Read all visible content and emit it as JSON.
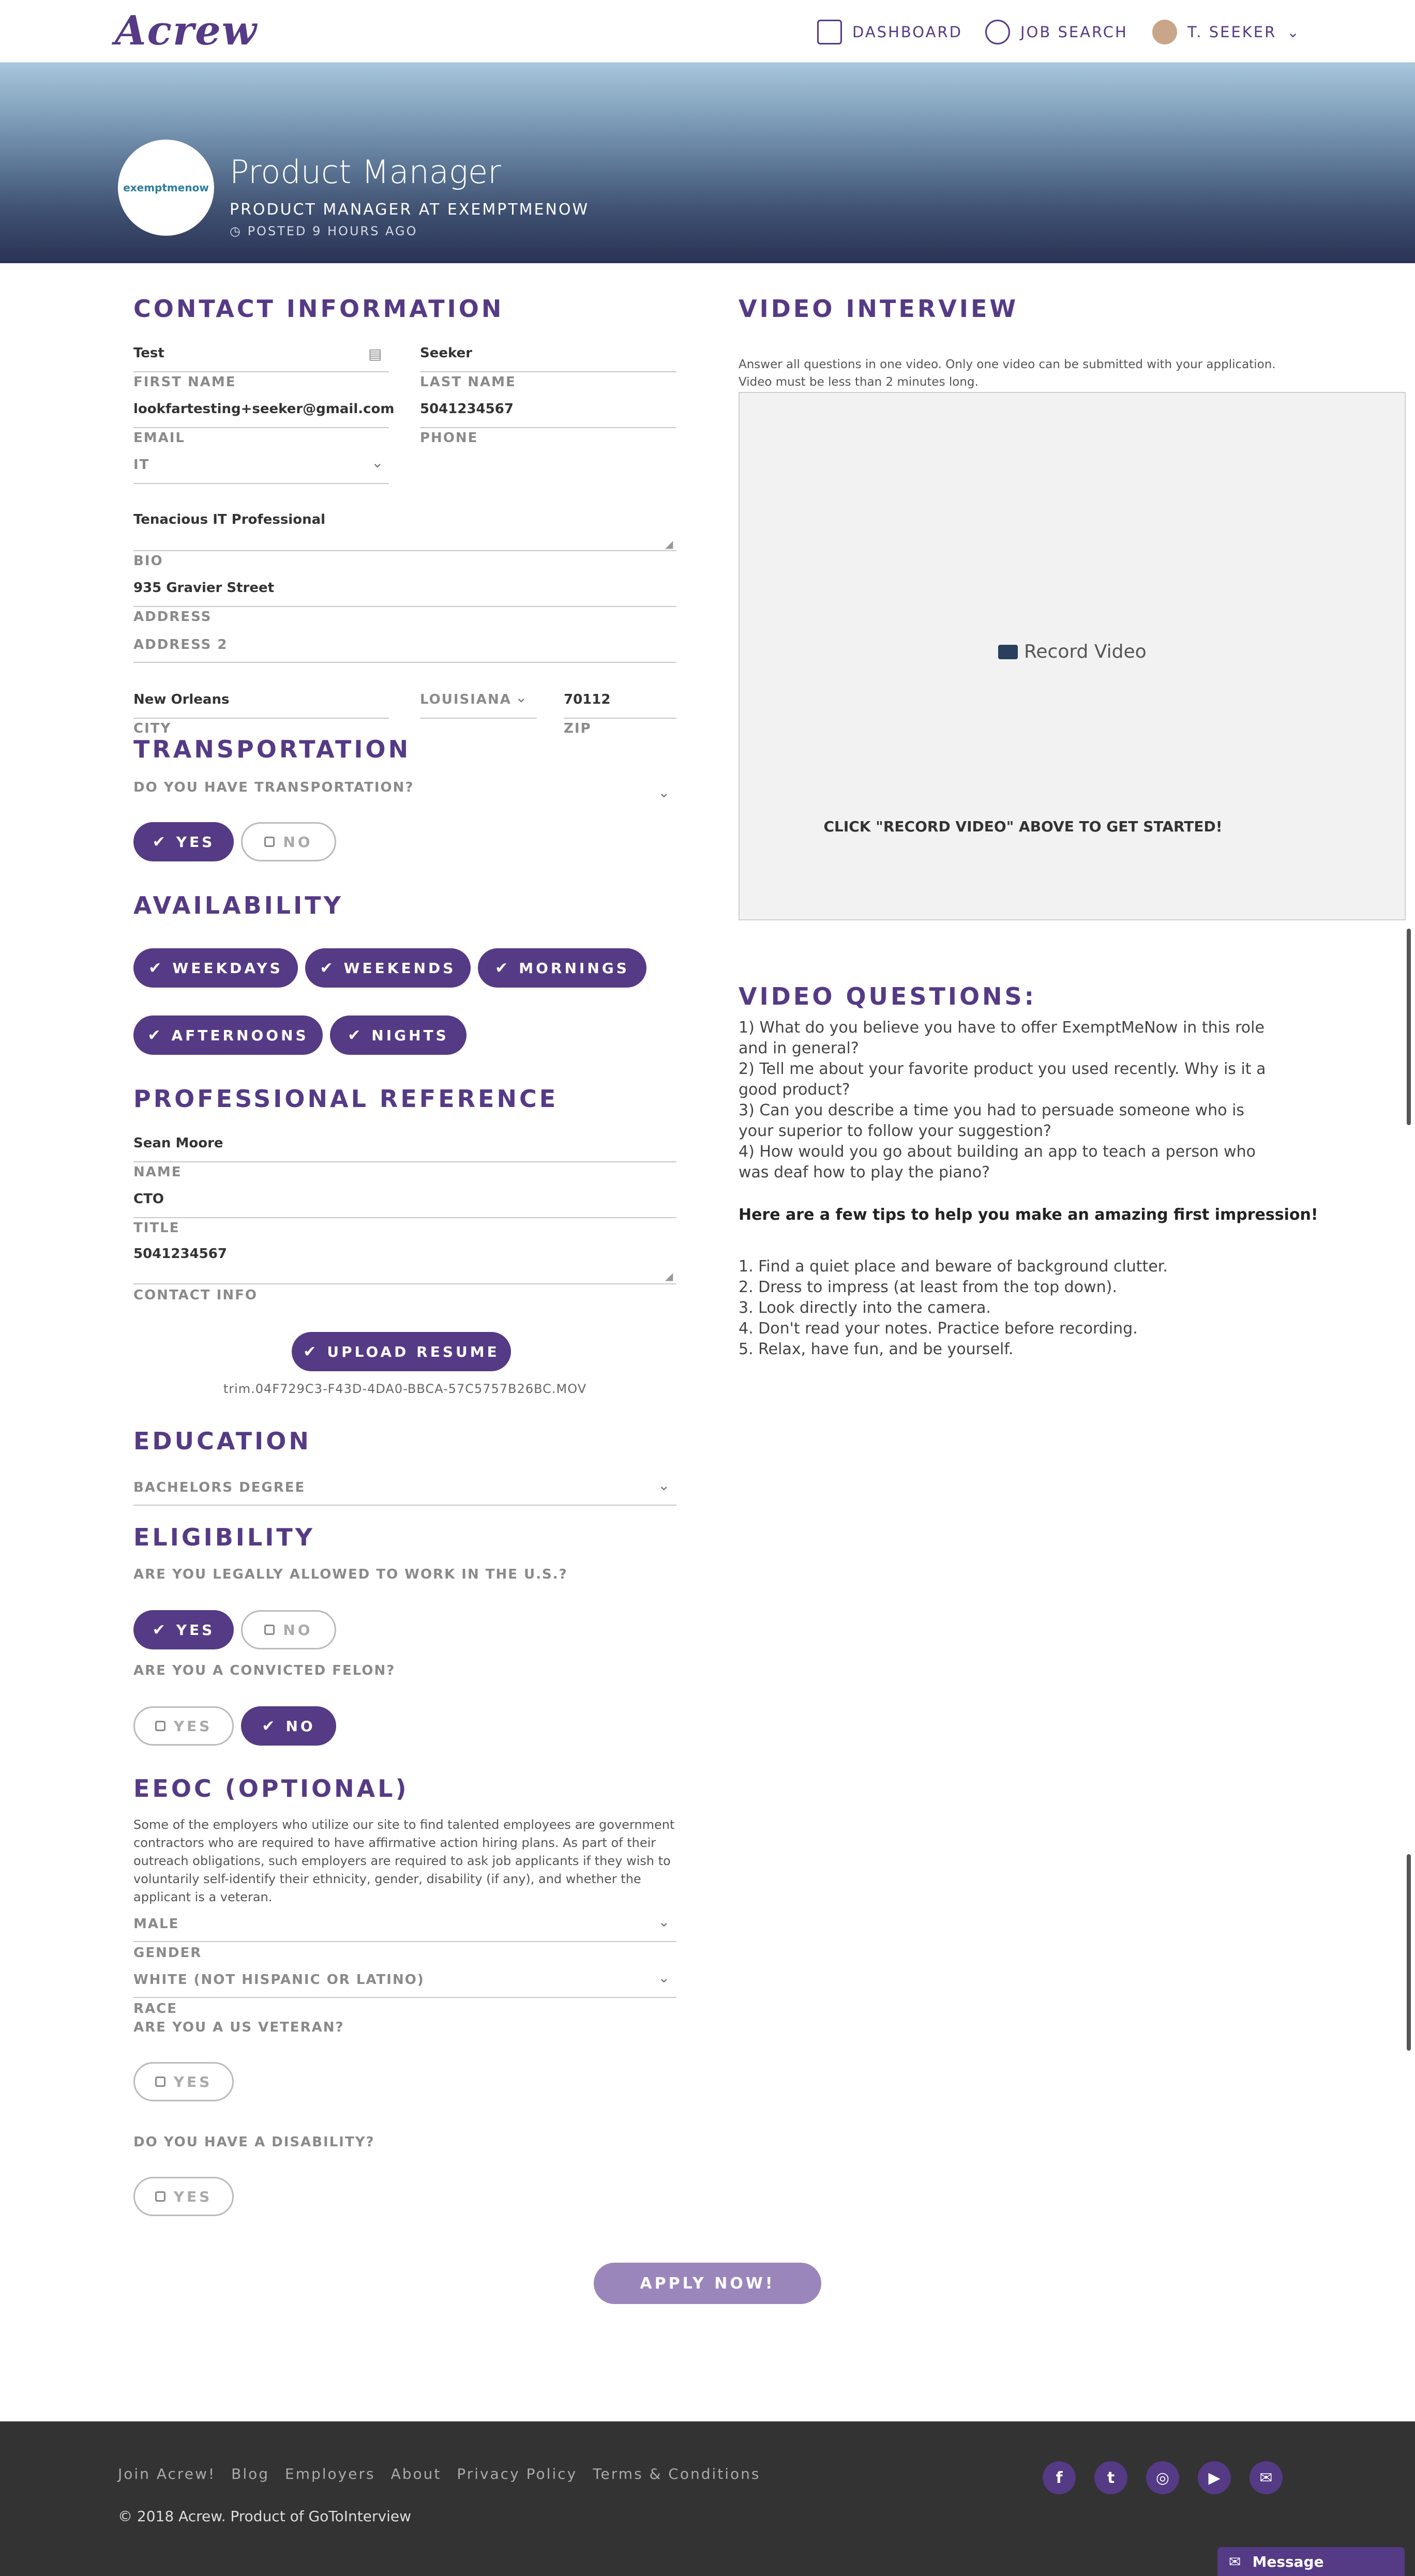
{
  "header": {
    "logo": "Acrew",
    "nav": {
      "dashboard": "DASHBOARD",
      "job_search": "JOB SEARCH",
      "user": "T. SEEKER"
    }
  },
  "banner": {
    "company_logo_text": "exemptmenow",
    "title": "Product Manager",
    "subtitle": "PRODUCT MANAGER AT EXEMPTMENOW",
    "posted": "POSTED 9 HOURS AGO"
  },
  "contact": {
    "heading": "CONTACT INFORMATION",
    "first_name": {
      "value": "Test",
      "label": "FIRST NAME"
    },
    "last_name": {
      "value": "Seeker",
      "label": "LAST NAME"
    },
    "email": {
      "value": "lookfartesting+seeker@gmail.com",
      "label": "EMAIL"
    },
    "phone": {
      "value": "5041234567",
      "label": "PHONE"
    },
    "industry": {
      "value": "IT"
    },
    "bio": {
      "value": "Tenacious IT Professional",
      "label": "BIO"
    },
    "address": {
      "value": "935 Gravier Street",
      "label": "ADDRESS"
    },
    "address2": {
      "label": "ADDRESS 2"
    },
    "city": {
      "value": "New Orleans",
      "label": "CITY"
    },
    "state": {
      "value": "LOUISIANA"
    },
    "zip": {
      "value": "70112",
      "label": "ZIP"
    }
  },
  "transportation": {
    "heading": "TRANSPORTATION",
    "question": "DO YOU HAVE TRANSPORTATION?",
    "yes": "YES",
    "no": "NO",
    "selected": "yes"
  },
  "availability": {
    "heading": "AVAILABILITY",
    "options": [
      "WEEKDAYS",
      "WEEKENDS",
      "MORNINGS",
      "AFTERNOONS",
      "NIGHTS"
    ]
  },
  "reference": {
    "heading": "PROFESSIONAL REFERENCE",
    "name": {
      "value": "Sean Moore",
      "label": "NAME"
    },
    "title": {
      "value": "CTO",
      "label": "TITLE"
    },
    "contact": {
      "value": "5041234567",
      "label": "CONTACT INFO"
    },
    "upload_label": "UPLOAD RESUME",
    "file_name": "trim.04F729C3-F43D-4DA0-BBCA-57C5757B26BC.MOV"
  },
  "education": {
    "heading": "EDUCATION",
    "value": "BACHELORS DEGREE"
  },
  "eligibility": {
    "heading": "ELIGIBILITY",
    "q1": "ARE YOU LEGALLY ALLOWED TO WORK IN THE U.S.?",
    "q2": "ARE YOU A CONVICTED FELON?",
    "yes": "YES",
    "no": "NO"
  },
  "eeoc": {
    "heading": "EEOC (OPTIONAL)",
    "text": "Some of the employers who utilize our site to find talented employees are government contractors who are required to have affirmative action hiring plans. As part of their outreach obligations, such employers are required to ask job applicants if they wish to voluntarily self-identify their ethnicity, gender, disability (if any), and whether the applicant is a veteran.",
    "gender": {
      "value": "MALE",
      "label": "GENDER"
    },
    "race": {
      "value": "WHITE (NOT HISPANIC OR LATINO)",
      "label": "RACE"
    },
    "veteran_q": "ARE YOU A US VETERAN?",
    "disability_q": "DO YOU HAVE A DISABILITY?",
    "yes": "YES"
  },
  "apply_label": "APPLY NOW!",
  "video": {
    "heading": "VIDEO INTERVIEW",
    "instructions": "Answer all questions in one video. Only one video can be submitted with your application. Video must be less than 2 minutes long.",
    "record_label": "Record Video",
    "cta": "CLICK \"RECORD VIDEO\" ABOVE TO GET STARTED!"
  },
  "questions": {
    "heading": "VIDEO QUESTIONS:",
    "items": [
      "1) What do you believe you have to offer ExemptMeNow in this role and in general?",
      "2) Tell me about your favorite product you used recently. Why is it a good product?",
      "3) Can you describe a time you had to persuade someone who is your superior to follow your suggestion?",
      "4) How would you go about building an app to teach a person who was deaf how to play the piano?"
    ],
    "tips_heading": "Here are a few tips to help you make an amazing first impression!",
    "tips": [
      "1. Find a quiet place and beware of background clutter.",
      "2. Dress to impress (at least from the top down).",
      "3. Look directly into the camera.",
      "4. Don't read your notes. Practice before recording.",
      "5. Relax, have fun, and be yourself."
    ]
  },
  "footer": {
    "links": [
      "Join Acrew!",
      "Blog",
      "Employers",
      "About",
      "Privacy Policy",
      "Terms & Conditions"
    ],
    "copyright": "© 2018 Acrew. Product of GoToInterview",
    "message_label": "Message"
  },
  "colors": {
    "brand": "#553a85",
    "accent": "#2aa6d6",
    "footer": "#333333"
  }
}
